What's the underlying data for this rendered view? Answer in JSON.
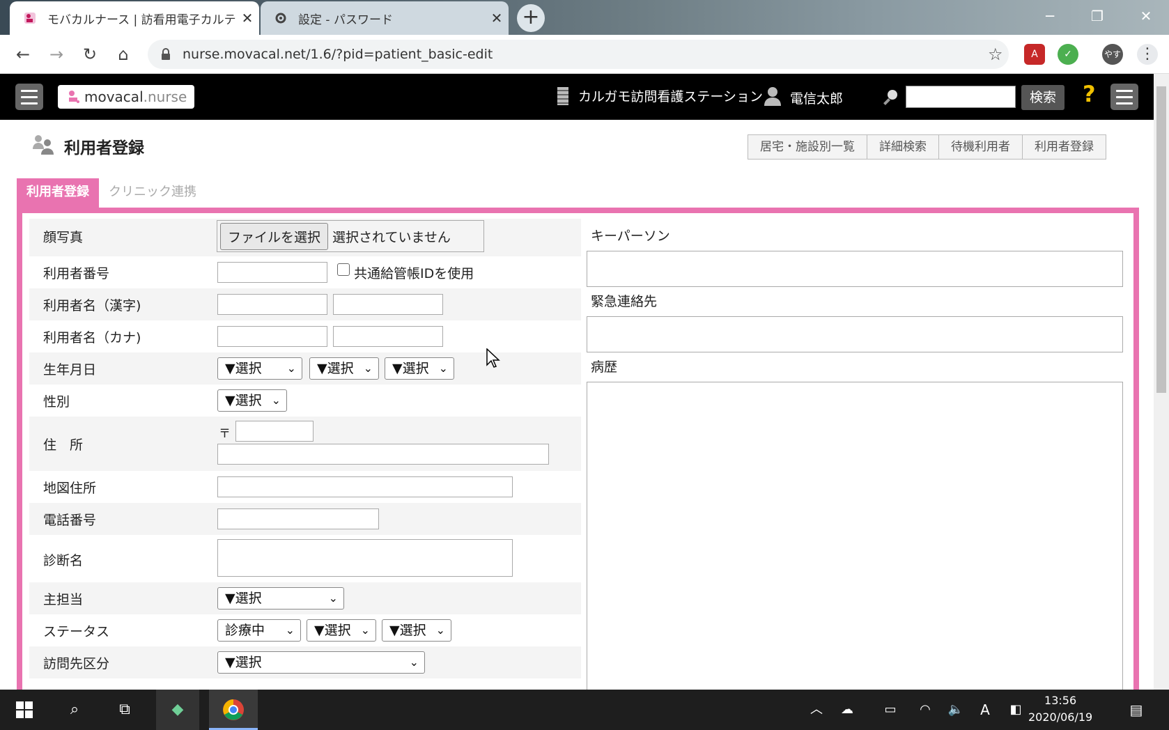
{
  "browser": {
    "tabs": [
      {
        "title": "モバカルナース | 訪看用電子カルテ",
        "active": true
      },
      {
        "title": "設定 - パスワード",
        "active": false
      }
    ],
    "url": "nurse.movacal.net/1.6/?pid=patient_basic-edit",
    "profile_label": "やす"
  },
  "app": {
    "logo_main": "movacal",
    "logo_sub": ".nurse",
    "station": "カルガモ訪問看護ステーション",
    "user": "電信太郎",
    "search_button": "検索",
    "help": "?"
  },
  "page": {
    "title": "利用者登録",
    "subnav": [
      "居宅・施設別一覧",
      "詳細検索",
      "待機利用者",
      "利用者登録"
    ],
    "form_tabs": [
      "利用者登録",
      "クリニック連携"
    ]
  },
  "form": {
    "photo_label": "顔写真",
    "file_button": "ファイルを選択",
    "file_status": "選択されていません",
    "user_number_label": "利用者番号",
    "shared_id_label": "共通給管帳IDを使用",
    "name_kanji_label": "利用者名（漢字)",
    "name_kana_label": "利用者名（カナ)",
    "birth_label": "生年月日",
    "select_placeholder": "▼選択",
    "gender_label": "性別",
    "address_label": "住　所",
    "postal_mark": "〒",
    "map_address_label": "地図住所",
    "phone_label": "電話番号",
    "diagnosis_label": "診断名",
    "primary_label": "主担当",
    "status_label": "ステータス",
    "status_value": "診療中",
    "visit_type_label": "訪問先区分",
    "keyperson_label": "キーパーソン",
    "emergency_label": "緊急連絡先",
    "history_label": "病歴"
  },
  "taskbar": {
    "time": "13:56",
    "date": "2020/06/19"
  },
  "colors": {
    "accent": "#e973b0",
    "appbar": "#000000"
  }
}
